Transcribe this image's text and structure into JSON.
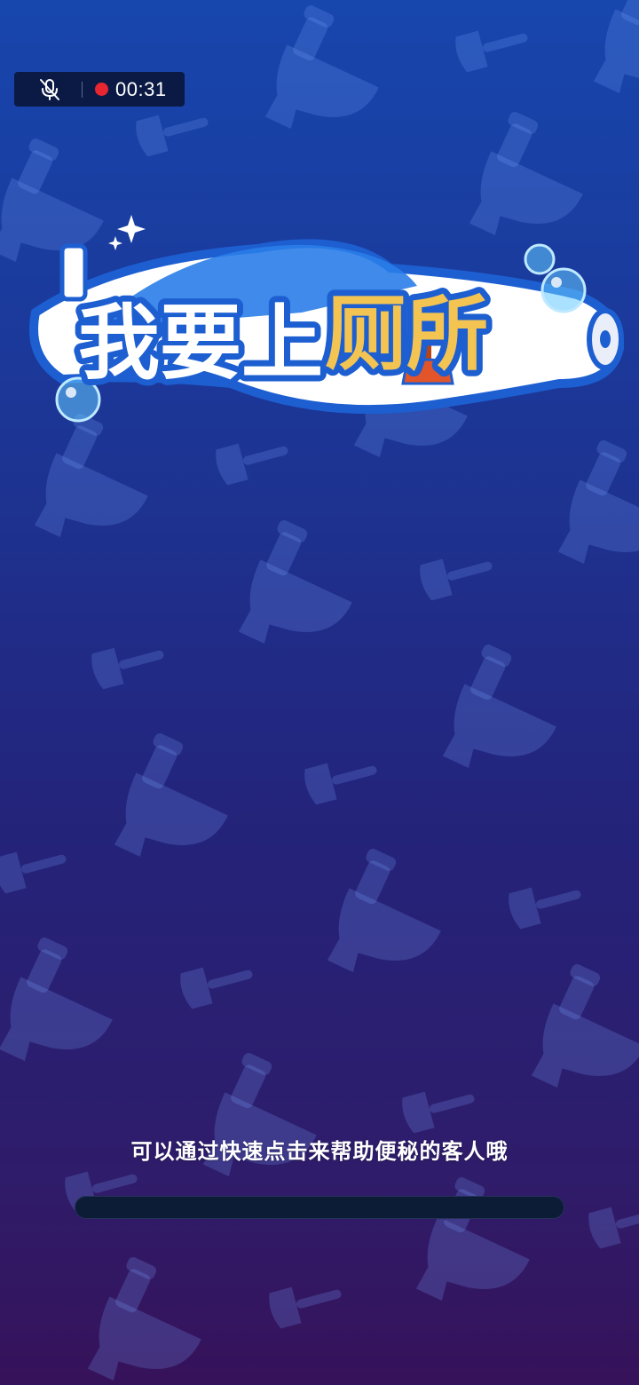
{
  "recording": {
    "mic_icon": "mic-muted-icon",
    "indicator_color": "#e8262f",
    "time": "00:31"
  },
  "logo": {
    "text": "我要上厕所"
  },
  "loading": {
    "hint": "可以通过快速点击来帮助便秘的客人哦",
    "progress": 0
  },
  "colors": {
    "background_top": "#1746ad",
    "background_bottom": "#36125a",
    "logo_text_white": "#ffffff",
    "logo_text_gold": "#f4c453",
    "logo_outline": "#1d5fd1"
  }
}
